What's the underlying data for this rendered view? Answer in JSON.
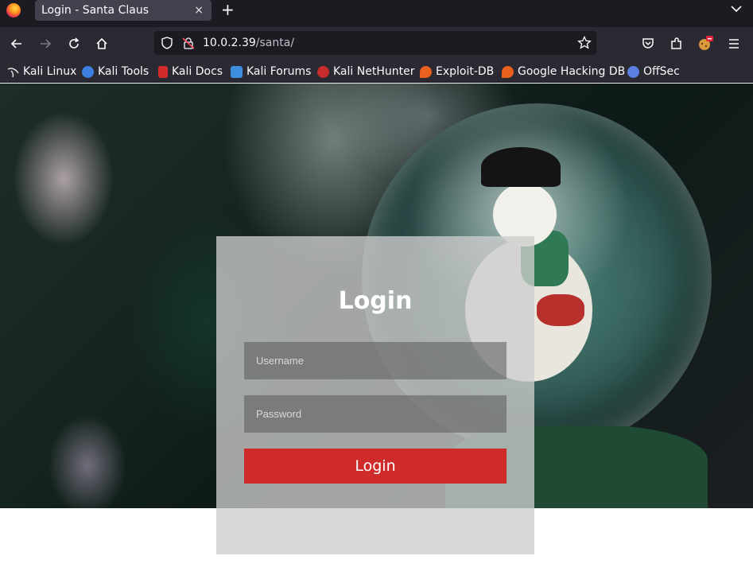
{
  "browser": {
    "tab_title": "Login - Santa Claus",
    "tab_close": "×",
    "new_tab": "+",
    "url_host": "10.0.2.39",
    "url_path": "/santa/"
  },
  "bookmarks": [
    {
      "label": "Kali Linux",
      "color": "#e0e0e0"
    },
    {
      "label": "Kali Tools",
      "color": "#3d7fe0"
    },
    {
      "label": "Kali Docs",
      "color": "#d22b2b"
    },
    {
      "label": "Kali Forums",
      "color": "#3d8fe0"
    },
    {
      "label": "Kali NetHunter",
      "color": "#c82b2b"
    },
    {
      "label": "Exploit-DB",
      "color": "#e8611f"
    },
    {
      "label": "Google Hacking DB",
      "color": "#e8611f"
    },
    {
      "label": "OffSec",
      "color": "#5a7fe0"
    }
  ],
  "login": {
    "title": "Login",
    "username_placeholder": "Username",
    "password_placeholder": "Password",
    "button_label": "Login"
  },
  "colors": {
    "accent": "#cf2b2b",
    "chrome_dark": "#1c1b22",
    "chrome": "#2b2a33"
  }
}
